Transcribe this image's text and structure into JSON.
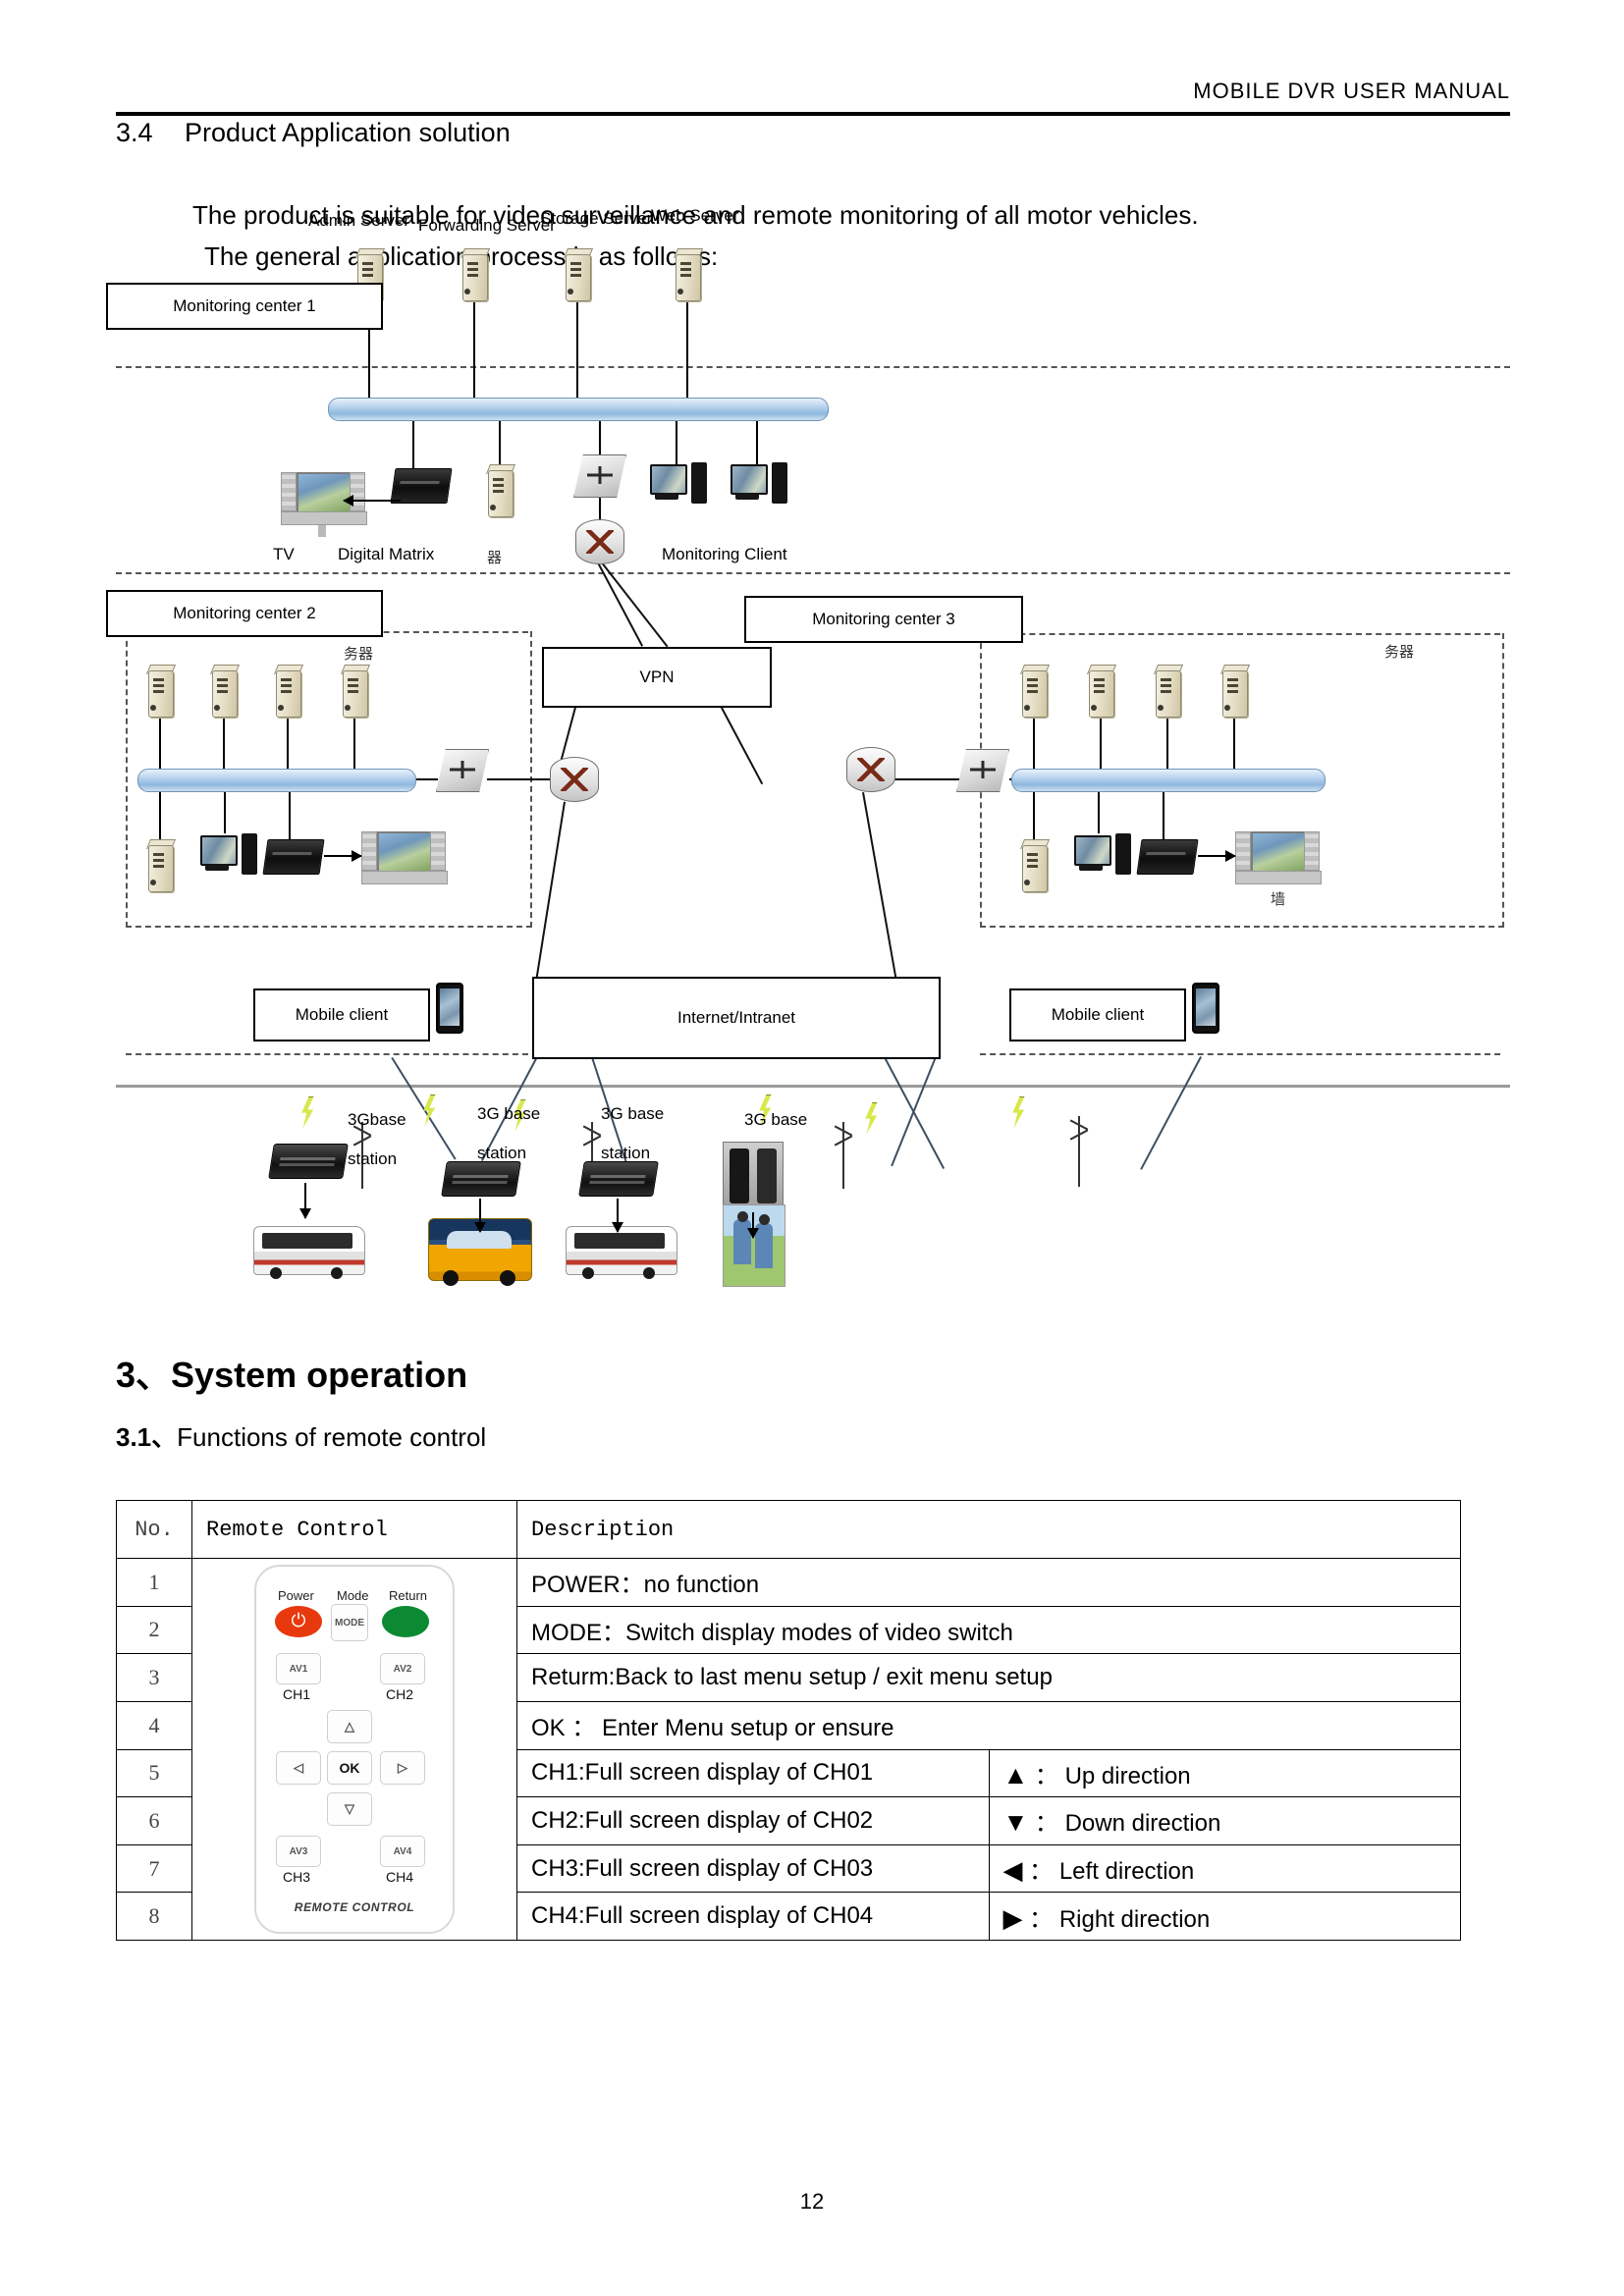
{
  "header": {
    "title": "MOBILE  DVR  USER  MANUAL"
  },
  "section": {
    "number": "3.4",
    "title": "Product Application solution",
    "para_line1": "The product is suitable for video surveillance and remote monitoring of all motor vehicles.",
    "para_line2": "The general application process is as follows:"
  },
  "diagram": {
    "boxes": {
      "center1": "Monitoring center 1",
      "center2": "Monitoring center 2",
      "center3": "Monitoring center 3",
      "vpn": "VPN",
      "internet": "Internet/Intranet",
      "mobile_client_left": "Mobile client",
      "mobile_client_right": "Mobile client"
    },
    "servers": {
      "admin": "Admin Server",
      "forwarding": "Forwarding Server",
      "storage": "Storage Server",
      "web": "Web Server"
    },
    "labels": {
      "tv": "TV",
      "digital_matrix": "Digital Matrix",
      "monitoring_client": "Monitoring Client",
      "cjk_server_mid": "器",
      "cjk_server_left": "务器",
      "cjk_server_right": "务器",
      "cjk_wall": "墙"
    },
    "base_stations": [
      {
        "line1": "3Gbase",
        "line2": "station"
      },
      {
        "line1": "3G base",
        "line2": "station"
      },
      {
        "line1": "3G base",
        "line2": "station"
      },
      {
        "line1": "3G base",
        "line2": ""
      }
    ]
  },
  "chapter": {
    "number": "3",
    "cjk_sep": "、",
    "title": "System operation",
    "sub_number": "3.1",
    "sub_title": "Functions of remote control"
  },
  "table": {
    "headers": {
      "no": "No.",
      "remote": "Remote Control",
      "description": "Description"
    },
    "rows": [
      {
        "no": "1",
        "desc": "POWER：no function",
        "dir": ""
      },
      {
        "no": "2",
        "desc": "MODE：Switch display modes of video switch",
        "dir": ""
      },
      {
        "no": "3",
        "desc": "Returm:Back to last menu setup / exit menu setup",
        "dir": ""
      },
      {
        "no": "4",
        "desc": "OK ： Enter Menu setup or ensure",
        "dir": ""
      },
      {
        "no": "5",
        "desc": "CH1:Full screen display of CH01",
        "dir_glyph": "▲",
        "dir": "： Up direction"
      },
      {
        "no": "6",
        "desc": "CH2:Full screen display of CH02",
        "dir_glyph": "▼",
        "dir": "： Down direction"
      },
      {
        "no": "7",
        "desc": "CH3:Full screen display of CH03",
        "dir_glyph": "◀",
        "dir": "： Left direction"
      },
      {
        "no": "8",
        "desc": "CH4:Full screen display of CH04",
        "dir_glyph": "▶",
        "dir": "： Right direction"
      }
    ]
  },
  "remote": {
    "label_power": "Power",
    "label_mode": "Mode",
    "label_return": "Return",
    "btn_mode": "MODE",
    "btn_av1": "AV1",
    "btn_av2": "AV2",
    "btn_av3": "AV3",
    "btn_av4": "AV4",
    "btn_ok": "OK",
    "btn_up": "△",
    "btn_down": "▽",
    "btn_left": "◁",
    "btn_right": "▷",
    "ch1": "CH1",
    "ch2": "CH2",
    "ch3": "CH3",
    "ch4": "CH4",
    "footer": "REMOTE CONTROL"
  },
  "footer": {
    "page_number": "12"
  }
}
